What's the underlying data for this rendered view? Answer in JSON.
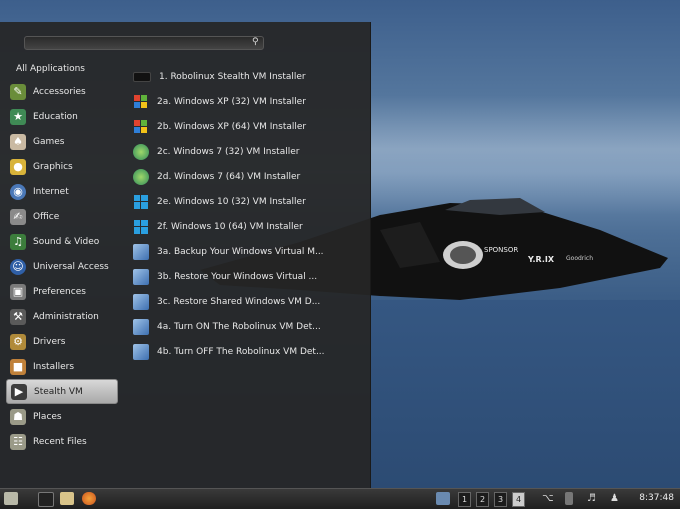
{
  "menu": {
    "search": {
      "value": "",
      "placeholder": ""
    },
    "categories_header": "All Applications",
    "categories": [
      {
        "label": "Accessories",
        "icon": "accessories-icon"
      },
      {
        "label": "Education",
        "icon": "education-icon"
      },
      {
        "label": "Games",
        "icon": "games-icon"
      },
      {
        "label": "Graphics",
        "icon": "graphics-icon"
      },
      {
        "label": "Internet",
        "icon": "internet-icon"
      },
      {
        "label": "Office",
        "icon": "office-icon"
      },
      {
        "label": "Sound & Video",
        "icon": "sound-video-icon"
      },
      {
        "label": "Universal Access",
        "icon": "universal-access-icon"
      },
      {
        "label": "Preferences",
        "icon": "preferences-icon"
      },
      {
        "label": "Administration",
        "icon": "administration-icon"
      },
      {
        "label": "Drivers",
        "icon": "drivers-icon"
      },
      {
        "label": "Installers",
        "icon": "installers-icon"
      },
      {
        "label": "Stealth VM",
        "icon": "folder-icon",
        "selected": true
      },
      {
        "label": "Places",
        "icon": "places-icon"
      },
      {
        "label": "Recent Files",
        "icon": "recent-files-icon"
      }
    ],
    "apps": [
      {
        "label": "1. Robolinux Stealth VM Installer",
        "icon": "terminal-icon"
      },
      {
        "label": "2a. Windows XP (32) VM Installer",
        "icon": "windows-xp-icon"
      },
      {
        "label": "2b. Windows XP (64) VM Installer",
        "icon": "windows-xp-icon"
      },
      {
        "label": "2c. Windows 7 (32) VM Installer",
        "icon": "windows-7-icon"
      },
      {
        "label": "2d. Windows 7 (64) VM Installer",
        "icon": "windows-7-icon"
      },
      {
        "label": "2e. Windows 10 (32) VM Installer",
        "icon": "windows-10-icon"
      },
      {
        "label": "2f. Windows 10 (64) VM Installer",
        "icon": "windows-10-icon"
      },
      {
        "label": "3a. Backup Your Windows Virtual M...",
        "icon": "vm-backup-icon"
      },
      {
        "label": "3b. Restore Your Windows Virtual ...",
        "icon": "vm-restore-icon"
      },
      {
        "label": "3c. Restore Shared Windows VM D...",
        "icon": "vm-shared-icon"
      },
      {
        "label": "4a. Turn ON The Robolinux VM Det...",
        "icon": "vm-on-icon"
      },
      {
        "label": "4b. Turn OFF The Robolinux VM Det...",
        "icon": "vm-off-icon"
      }
    ]
  },
  "wallpaper": {
    "badge_text": "SPONSOR",
    "tail_text": "Y.R.IX",
    "side_text": "Goodrich"
  },
  "taskbar": {
    "workspaces": [
      "1",
      "2",
      "3",
      "4"
    ],
    "clock": "8:37:48"
  }
}
